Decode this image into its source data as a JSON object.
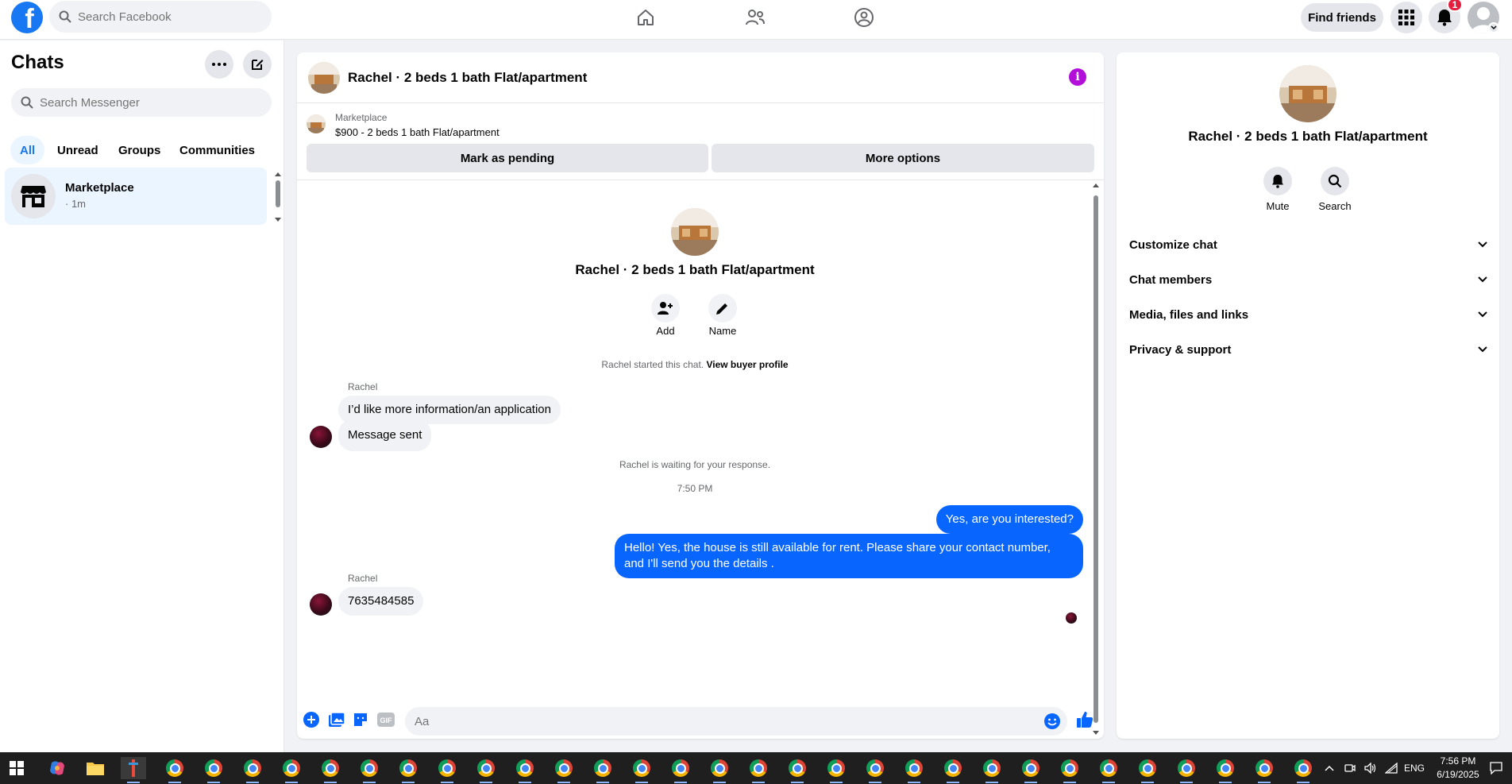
{
  "topbar": {
    "search_placeholder": "Search Facebook",
    "find_friends": "Find friends",
    "notification_count": "1"
  },
  "sidebar": {
    "title": "Chats",
    "search_placeholder": "Search Messenger",
    "tabs": [
      {
        "label": "All",
        "active": true
      },
      {
        "label": "Unread"
      },
      {
        "label": "Groups"
      },
      {
        "label": "Communities"
      }
    ],
    "chats": [
      {
        "name": "Marketplace",
        "time": "· 1m"
      }
    ]
  },
  "conversation": {
    "title": "Rachel · 2 beds 1 bath Flat/apartment",
    "marketplace_label": "Marketplace",
    "listing_detail": "$900 - 2 beds 1 bath Flat/apartment",
    "mark_pending": "Mark as pending",
    "more_options": "More options",
    "name": "Rachel · 2 beds 1 bath Flat/apartment",
    "add_label": "Add",
    "name_label": "Name",
    "started_text": "Rachel started this chat.",
    "view_profile": "View buyer profile",
    "messages": [
      {
        "sender": "Rachel",
        "text": "I’d like more information/an application"
      },
      {
        "text": "Message sent"
      },
      {
        "text": "Yes, are you interested?"
      },
      {
        "text": "Hello! Yes, the house is still available for rent. Please share your contact number, and I'll send you the details ."
      },
      {
        "sender": "Rachel",
        "text": "7635484585"
      }
    ],
    "waiting_text": "Rachel is waiting for your response.",
    "timestamp": "7:50 PM",
    "composer_placeholder": "Aa"
  },
  "right_panel": {
    "name": "Rachel · 2 beds 1 bath Flat/apartment",
    "mute_label": "Mute",
    "search_label": "Search",
    "sections": [
      "Customize chat",
      "Chat members",
      "Media, files and links",
      "Privacy & support"
    ]
  },
  "taskbar": {
    "language": "ENG",
    "time": "7:56 PM",
    "date": "6/19/2025"
  },
  "colors": {
    "brand": "#1877f2",
    "messenger_blue": "#0866ff",
    "info_purple": "#b20fd9"
  }
}
